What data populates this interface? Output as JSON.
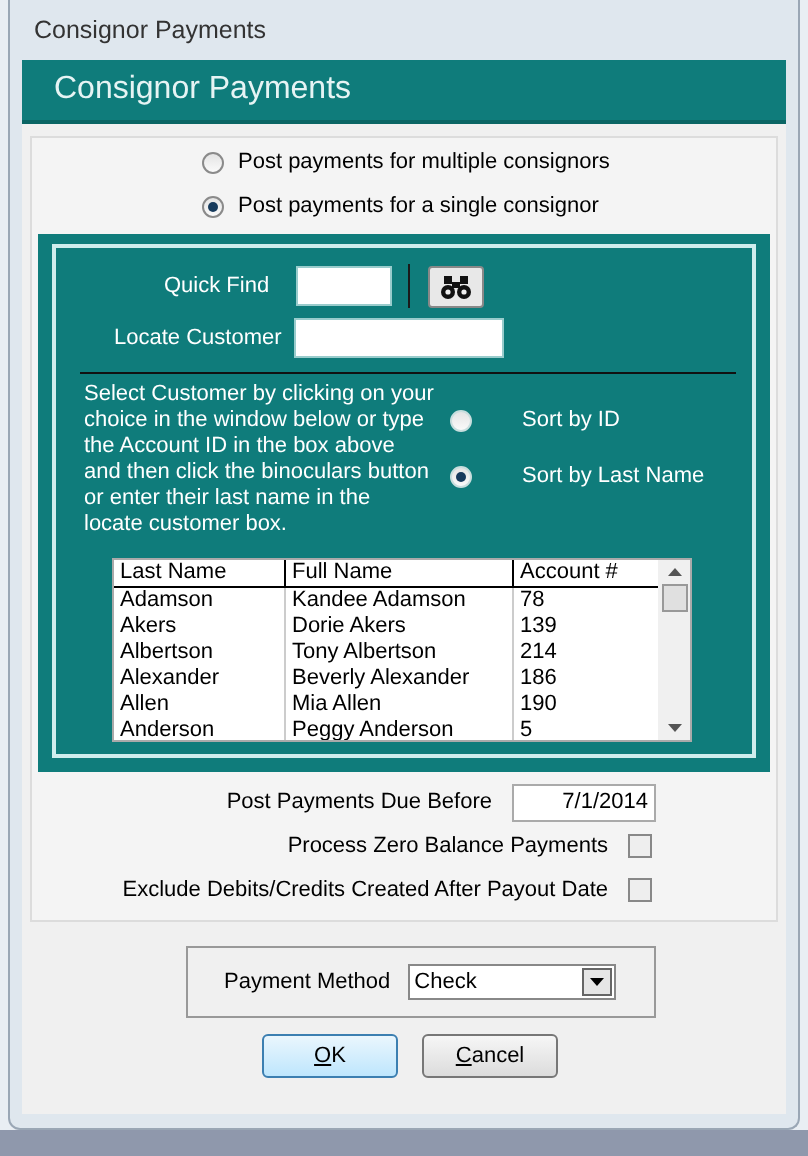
{
  "window": {
    "title": "Consignor Payments"
  },
  "header": {
    "title": "Consignor Payments"
  },
  "post_mode": [
    {
      "label": "Post payments for multiple consignors",
      "selected": false
    },
    {
      "label": "Post payments for a single consignor",
      "selected": true
    }
  ],
  "quick_find": {
    "label": "Quick Find"
  },
  "locate_customer": {
    "label": "Locate Customer"
  },
  "instructions": "Select Customer by clicking on your choice in the window below or type the Account ID in the box above and then click the binoculars button or enter their last name in the locate customer box.",
  "sort": [
    {
      "label": "Sort by ID",
      "selected": false
    },
    {
      "label": "Sort by Last Name",
      "selected": true
    }
  ],
  "table": {
    "columns": [
      "Last Name",
      "Full Name",
      "Account #"
    ],
    "rows": [
      [
        "Adamson",
        "Kandee Adamson",
        "78"
      ],
      [
        "Akers",
        "Dorie Akers",
        "139"
      ],
      [
        "Albertson",
        "Tony Albertson",
        "214"
      ],
      [
        "Alexander",
        "Beverly Alexander",
        "186"
      ],
      [
        "Allen",
        "Mia Allen",
        "190"
      ],
      [
        "Anderson",
        "Peggy Anderson",
        "5"
      ]
    ]
  },
  "due_before": {
    "label": "Post Payments Due Before",
    "value": "7/1/2014"
  },
  "options": [
    {
      "label": "Process Zero Balance Payments",
      "checked": false
    },
    {
      "label": "Exclude Debits/Credits Created After Payout Date",
      "checked": false
    }
  ],
  "payment_method": {
    "label": "Payment Method",
    "value": "Check"
  },
  "buttons": [
    {
      "label": "OK",
      "default": true
    },
    {
      "label": "Cancel",
      "default": false
    }
  ]
}
